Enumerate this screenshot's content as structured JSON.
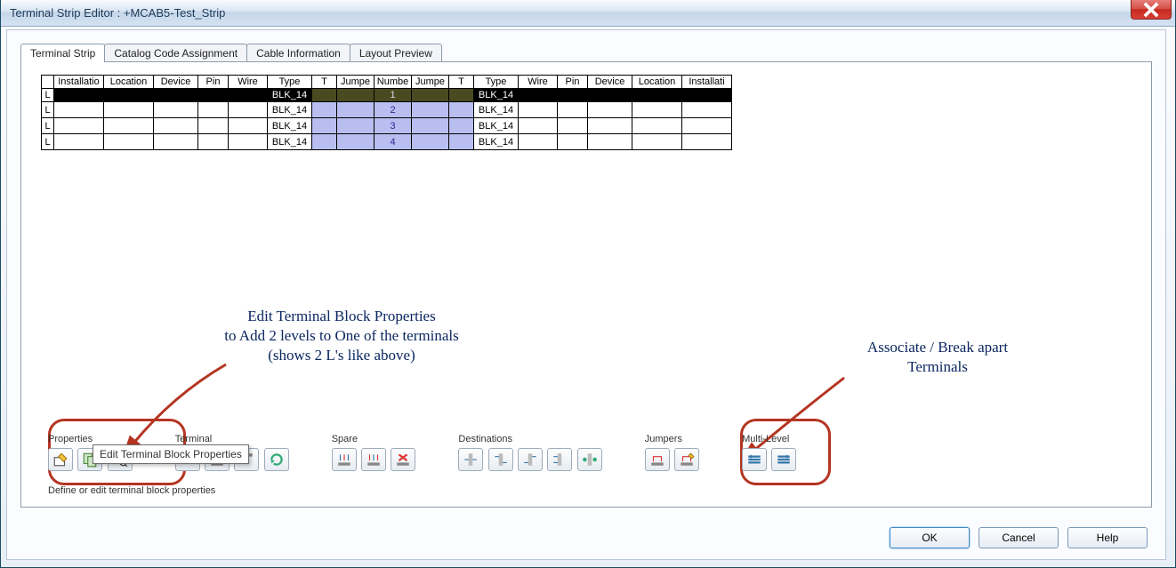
{
  "window": {
    "title": "Terminal Strip Editor : +MCAB5-Test_Strip"
  },
  "tabs": [
    {
      "label": "Terminal Strip",
      "active": true
    },
    {
      "label": "Catalog Code Assignment"
    },
    {
      "label": "Cable Information"
    },
    {
      "label": "Layout Preview"
    }
  ],
  "table": {
    "headers_left": [
      "Installatio",
      "Location",
      "Device",
      "Pin",
      "Wire",
      "Type",
      "T",
      "Jumpe",
      "Numbe",
      "Jumpe",
      "T",
      "Type",
      "Wire",
      "Pin",
      "Device",
      "Location",
      "Installati"
    ],
    "rows": [
      {
        "L": "L",
        "type_l": "BLK_14",
        "num": "1",
        "type_r": "BLK_14",
        "selected": true
      },
      {
        "L": "L",
        "type_l": "BLK_14",
        "num": "2",
        "type_r": "BLK_14",
        "selected": false
      },
      {
        "L": "L",
        "type_l": "BLK_14",
        "num": "3",
        "type_r": "BLK_14",
        "selected": false
      },
      {
        "L": "L",
        "type_l": "BLK_14",
        "num": "4",
        "type_r": "BLK_14",
        "selected": false
      }
    ]
  },
  "annotations": {
    "a1_line1": "Edit Terminal Block Properties",
    "a1_line2": "to Add 2 levels to One of the terminals",
    "a1_line3": "(shows 2 L's like above)",
    "a2_line1": "Associate / Break apart",
    "a2_line2": "Terminals"
  },
  "toolgroups": {
    "properties": "Properties",
    "terminal": "Terminal",
    "spare": "Spare",
    "destinations": "Destinations",
    "jumpers": "Jumpers",
    "multilevel": "Multi-Level"
  },
  "tooltip": "Edit Terminal Block Properties",
  "status": "Define or edit terminal block properties",
  "buttons": {
    "ok": "OK",
    "cancel": "Cancel",
    "help": "Help"
  }
}
